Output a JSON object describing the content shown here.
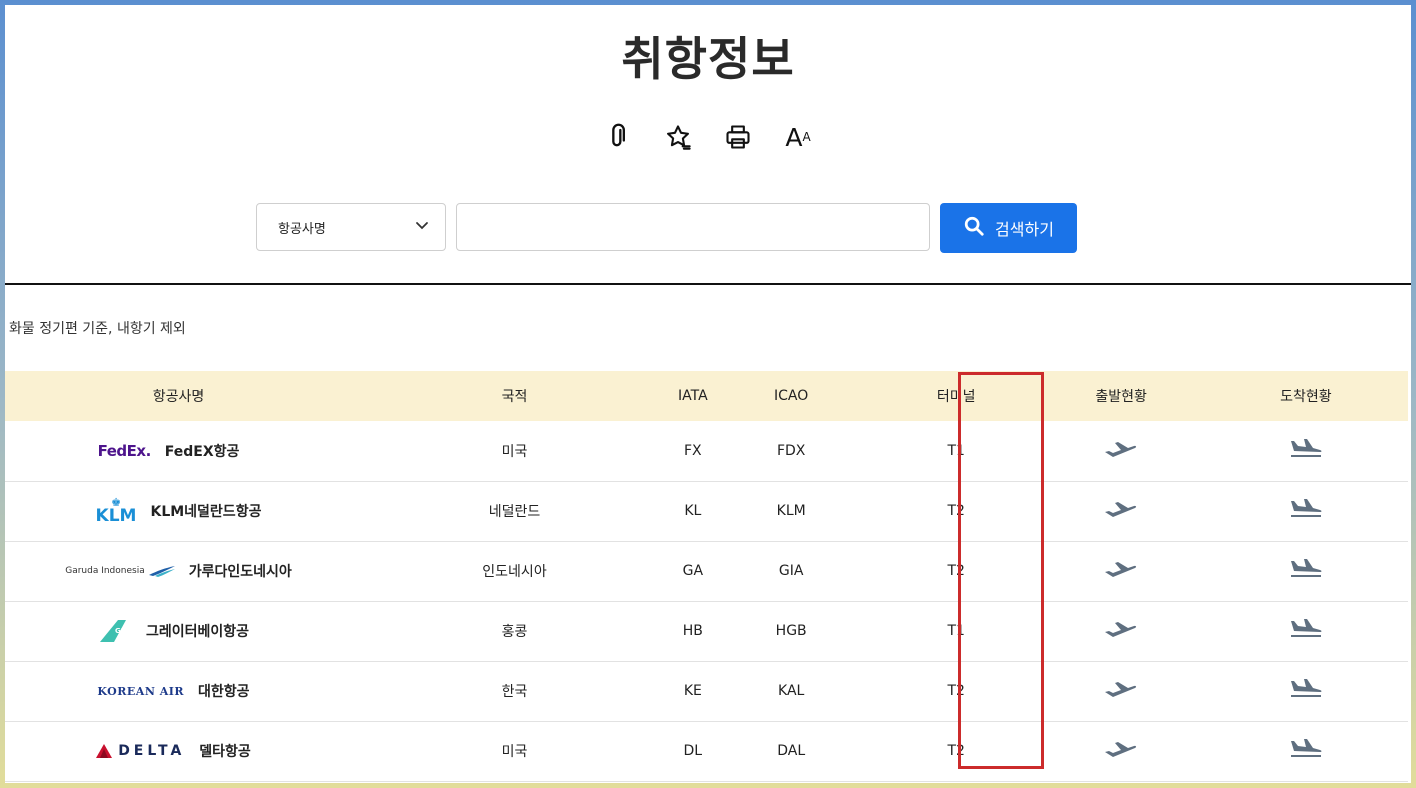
{
  "page": {
    "title": "취항정보"
  },
  "toolbar": {
    "icons": [
      "link-icon",
      "favorite-icon",
      "print-icon",
      "font-size-icon"
    ],
    "font_big": "A",
    "font_small": "A"
  },
  "search": {
    "select_value": "항공사명",
    "input_value": "",
    "button_label": "검색하기"
  },
  "note": "화물 정기편 기준, 내항기 제외",
  "table": {
    "headers": [
      "항공사명",
      "국적",
      "IATA",
      "ICAO",
      "터미널",
      "출발현황",
      "도착현황"
    ],
    "rows": [
      {
        "logo": "FedEx.",
        "name": "FedEX항공",
        "country": "미국",
        "iata": "FX",
        "icao": "FDX",
        "terminal": "T1"
      },
      {
        "logo": "KLM",
        "name": "KLM네덜란드항공",
        "country": "네덜란드",
        "iata": "KL",
        "icao": "KLM",
        "terminal": "T2"
      },
      {
        "logo": "Garuda Indonesia",
        "name": "가루다인도네시아",
        "country": "인도네시아",
        "iata": "GA",
        "icao": "GIA",
        "terminal": "T2"
      },
      {
        "logo": "GBA",
        "name": "그레이터베이항공",
        "country": "홍콩",
        "iata": "HB",
        "icao": "HGB",
        "terminal": "T1"
      },
      {
        "logo": "KOREAN AIR",
        "name": "대한항공",
        "country": "한국",
        "iata": "KE",
        "icao": "KAL",
        "terminal": "T2"
      },
      {
        "logo": "DELTA",
        "name": "델타항공",
        "country": "미국",
        "iata": "DL",
        "icao": "DAL",
        "terminal": "T2"
      }
    ]
  },
  "colors": {
    "accent": "#1a73e8",
    "header_bg": "#faf1d2",
    "highlight": "#cc2b2b",
    "plane": "#5f6f80"
  }
}
